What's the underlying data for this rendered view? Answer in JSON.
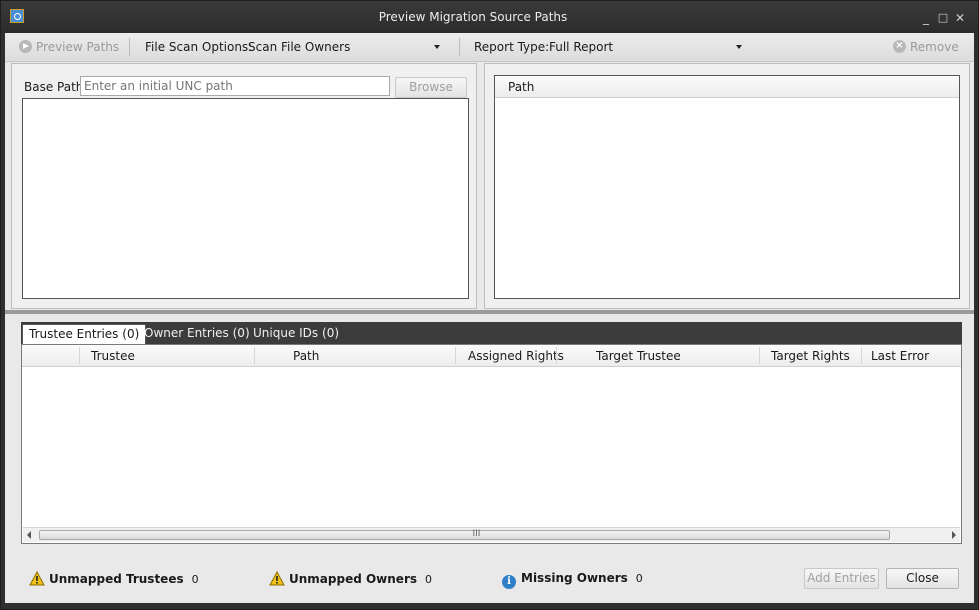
{
  "window": {
    "title": "Preview Migration Source Paths",
    "minimize_glyph": "_",
    "maximize_glyph": "□",
    "close_glyph": "✕"
  },
  "toolbar": {
    "preview_paths_label": "Preview Paths",
    "file_scan_options_label": "File Scan Options:",
    "file_scan_options_value": "Scan File Owners",
    "report_type_label": "Report Type:",
    "report_type_value": "Full Report",
    "remove_label": "Remove"
  },
  "source_pane": {
    "base_path_label": "Base Path",
    "base_path_placeholder": "Enter an initial UNC path",
    "browse_label": "Browse"
  },
  "paths_pane": {
    "columns": [
      "Path"
    ]
  },
  "tabs": [
    {
      "label": "Trustee Entries",
      "count": "(0)"
    },
    {
      "label": "Owner Entries",
      "count": "(0)"
    },
    {
      "label": "Unique IDs",
      "count": "(0)"
    }
  ],
  "entries_grid": {
    "columns": [
      "Trustee",
      "Path",
      "Assigned Rights",
      "Target Trustee",
      "Target Rights",
      "Last Error"
    ],
    "scroll_grip": "III"
  },
  "status": {
    "unmapped_trustees_label": "Unmapped Trustees",
    "unmapped_trustees_count": "0",
    "unmapped_owners_label": "Unmapped Owners",
    "unmapped_owners_count": "0",
    "missing_owners_label": "Missing Owners",
    "missing_owners_count": "0",
    "info_glyph": "i"
  },
  "actions": {
    "add_entries_label": "Add Entries",
    "close_label": "Close"
  },
  "colors": {
    "title_bar": "#2f2f2f",
    "tab_strip": "#3c3c3c",
    "warning": "#f2c21b",
    "info": "#2f7fc8"
  }
}
